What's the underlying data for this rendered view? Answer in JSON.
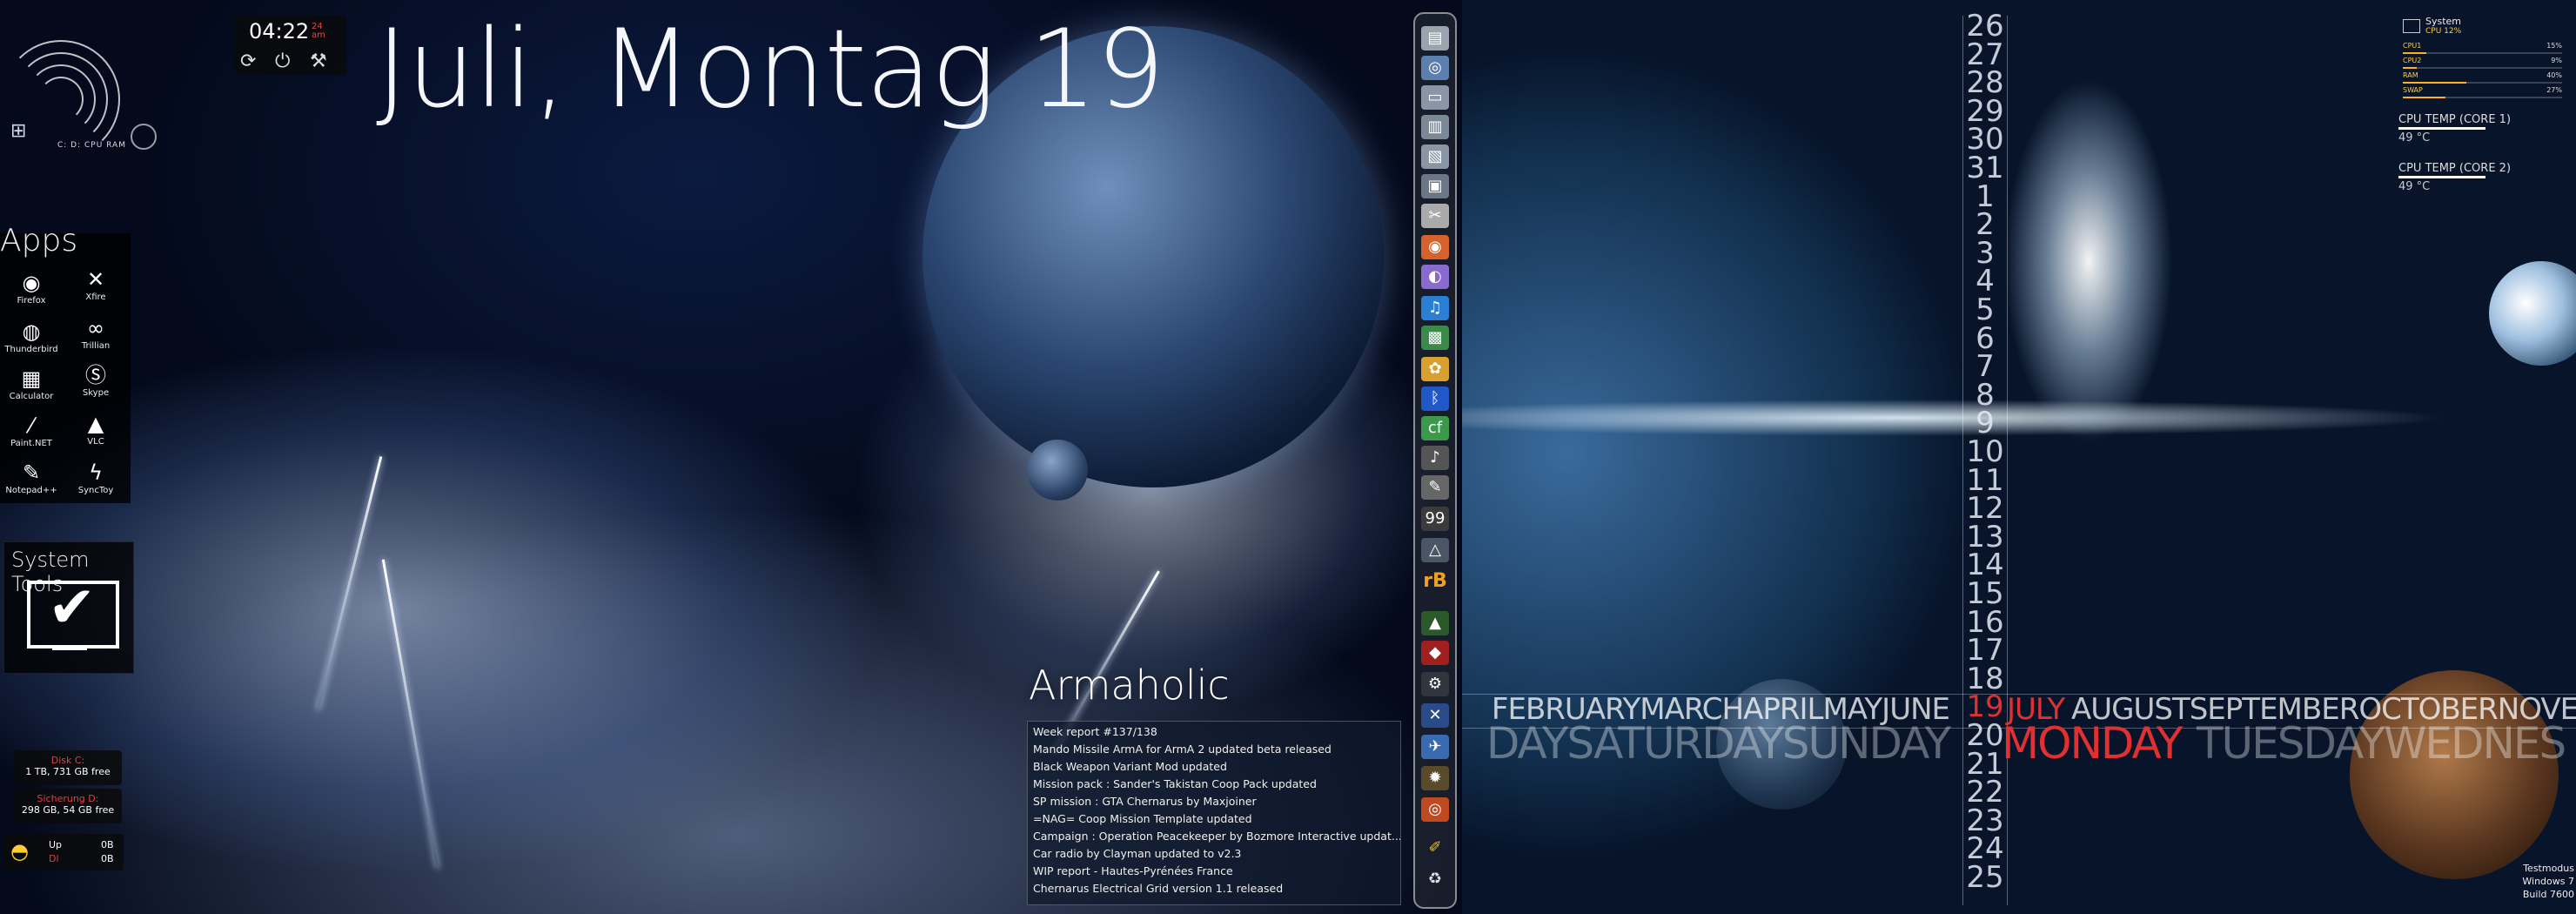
{
  "header": {
    "date_title": "Juli, Montag 19"
  },
  "clock": {
    "time": "04:22",
    "ampm_top": "24",
    "ampm_bottom": "am"
  },
  "gauges": {
    "labels": "C: D: CPU RAM"
  },
  "apps": {
    "title": "Apps",
    "items": [
      {
        "label": "Firefox",
        "icon": "firefox-icon"
      },
      {
        "label": "Xfire",
        "icon": "xfire-icon"
      },
      {
        "label": "Thunderbird",
        "icon": "thunderbird-icon"
      },
      {
        "label": "Trillian",
        "icon": "trillian-icon"
      },
      {
        "label": "Calculator",
        "icon": "calculator-icon"
      },
      {
        "label": "Skype",
        "icon": "skype-icon"
      },
      {
        "label": "Paint.NET",
        "icon": "paintnet-icon"
      },
      {
        "label": "VLC",
        "icon": "vlc-icon"
      },
      {
        "label": "Notepad++",
        "icon": "notepad-icon"
      },
      {
        "label": "SyncToy",
        "icon": "synctoy-icon"
      }
    ]
  },
  "system_tools": {
    "title": "System Tools"
  },
  "disks": [
    {
      "name": "Disk C:",
      "size": "1 TB, 731 GB free"
    },
    {
      "name": "Sicherung D:",
      "size": "298 GB, 54 GB free"
    }
  ],
  "network": {
    "up_label": "Up",
    "dn_label": "Dl",
    "up_value": "0B",
    "dn_value": "0B"
  },
  "armaholic": {
    "title": "Armaholic",
    "news": [
      "Week report #137/138",
      "Mando Missile ArmA for ArmA 2 updated beta released",
      "Black Weapon Variant Mod updated",
      "Mission pack : Sander's Takistan Coop Pack updated",
      "SP mission : GTA Chernarus by Maxjoiner",
      "=NAG= Coop Mission Template updated",
      "Campaign : Operation Peacekeeper by Bozmore Interactive updat...",
      "Car radio by Clayman updated to v2.3",
      "WIP report - Hautes-Pyrénées France",
      "Chernarus Electrical Grid version 1.1 released"
    ]
  },
  "calendar": {
    "days": [
      "26",
      "27",
      "28",
      "29",
      "30",
      "31",
      "1",
      "2",
      "3",
      "4",
      "5",
      "6",
      "7",
      "8",
      "9",
      "10",
      "11",
      "12",
      "13",
      "14",
      "15",
      "16",
      "17",
      "18",
      "19",
      "20",
      "21",
      "22",
      "23",
      "24",
      "25"
    ],
    "current_day": "19",
    "months_before": "FEBRUARYMARCHAPRILMAYJUNE",
    "month_current": "JULY",
    "months_after": "AUGUSTSEPTEMBEROCTOBERNOVEM",
    "weekdays_before": "DAYSATURDAYSUNDAY",
    "weekday_current": "MONDAY",
    "weekdays_after": "TUESDAYWEDNES",
    "highlight_color": "#e03030"
  },
  "system_monitor": {
    "name": "System",
    "cpu_summary": "CPU 12%",
    "meters": [
      {
        "label": "CPU1",
        "value": "15%",
        "fill": 15
      },
      {
        "label": "CPU2",
        "value": "9%",
        "fill": 9
      },
      {
        "label": "RAM",
        "value": "40%",
        "fill": 40
      },
      {
        "label": "SWAP",
        "value": "27%",
        "fill": 27
      }
    ],
    "temps": [
      {
        "label": "CPU TEMP (CORE 1)",
        "value": "49 °C"
      },
      {
        "label": "CPU TEMP (CORE 2)",
        "value": "49 °C"
      }
    ]
  },
  "watermark": {
    "line1": "Testmodus",
    "line2": "Windows 7",
    "line3": "Build 7600"
  }
}
